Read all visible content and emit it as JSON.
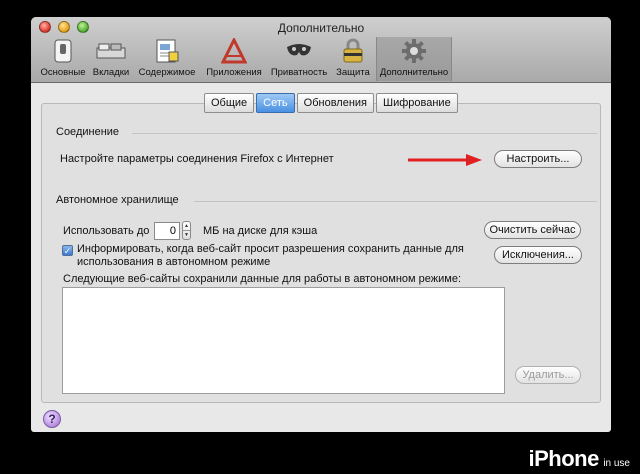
{
  "window": {
    "title": "Дополнительно"
  },
  "toolbar": {
    "items": [
      {
        "label": "Основные",
        "icon": "switch-icon"
      },
      {
        "label": "Вкладки",
        "icon": "tabs-icon"
      },
      {
        "label": "Содержимое",
        "icon": "content-icon"
      },
      {
        "label": "Приложения",
        "icon": "applications-icon"
      },
      {
        "label": "Приватность",
        "icon": "privacy-mask-icon"
      },
      {
        "label": "Защита",
        "icon": "padlock-icon"
      },
      {
        "label": "Дополнительно",
        "icon": "gear-icon"
      }
    ],
    "selected": "Дополнительно"
  },
  "tabs": [
    {
      "label": "Общие",
      "selected": false
    },
    {
      "label": "Сеть",
      "selected": true
    },
    {
      "label": "Обновления",
      "selected": false
    },
    {
      "label": "Шифрование",
      "selected": false
    }
  ],
  "connection": {
    "title": "Соединение",
    "description": "Настройте параметры соединения Firefox с Интернет",
    "configure_button": "Настроить..."
  },
  "offline": {
    "title": "Автономное хранилище",
    "use_prefix": "Использовать до",
    "cache_value": "0",
    "use_suffix": "МБ на диске для кэша",
    "clear_button": "Очистить сейчас",
    "notify_checked": true,
    "notify_text_line1": "Информировать, когда веб-сайт просит разрешения сохранить данные для",
    "notify_text_line2": "использования в автономном режиме",
    "exceptions_button": "Исключения...",
    "list_label": "Следующие веб-сайты сохранили данные для работы в автономном режиме:",
    "remove_button": "Удалить..."
  },
  "help_button": "?",
  "watermark": {
    "brand": "iPhone",
    "suffix": "in use"
  },
  "colors": {
    "selected_tab": "#4a90e2",
    "arrow": "#e02020",
    "help": "#b68be0"
  }
}
